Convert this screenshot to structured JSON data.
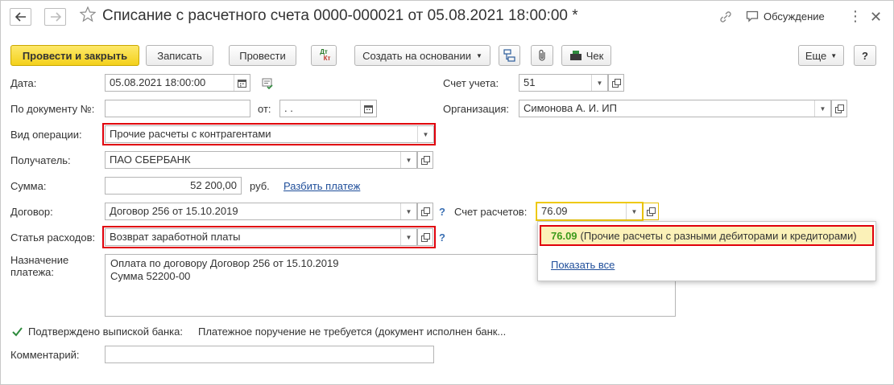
{
  "header": {
    "title": "Списание с расчетного счета 0000-000021 от 05.08.2021 18:00:00 *",
    "discussion": "Обсуждение"
  },
  "toolbar": {
    "post_close": "Провести и закрыть",
    "save": "Записать",
    "post": "Провести",
    "dtkt_dt": "Дт",
    "dtkt_kt": "Кт",
    "create_based": "Создать на основании",
    "check": "Чек",
    "more": "Еще",
    "help": "?"
  },
  "form": {
    "date_label": "Дата:",
    "date_value": "05.08.2021 18:00:00",
    "doc_label": "По документу №:",
    "doc_value": "",
    "from_label": "от:",
    "from_value": " .  .",
    "operation_label": "Вид операции:",
    "operation_value": "Прочие расчеты с контрагентами",
    "recipient_label": "Получатель:",
    "recipient_value": "ПАО СБЕРБАНК",
    "sum_label": "Сумма:",
    "sum_value": "52 200,00",
    "currency": "руб.",
    "split_link": "Разбить платеж",
    "contract_label": "Договор:",
    "contract_value": "Договор 256 от 15.10.2019",
    "expense_label": "Статья расходов:",
    "expense_value": "Возврат заработной платы",
    "purpose_label_1": "Назначение",
    "purpose_label_2": "платежа:",
    "purpose_line_1": "Оплата по договору Договор 256 от 15.10.2019",
    "purpose_line_2": "Сумма 52200-00",
    "confirmed_label": "Подтверждено выпиской банка:",
    "confirmed_checked": true,
    "order_note": "Платежное поручение не требуется (документ исполнен банк...",
    "comment_label": "Комментарий:",
    "comment_value": "",
    "account_label": "Счет учета:",
    "account_value": "51",
    "org_label": "Организация:",
    "org_value": "Симонова А. И. ИП",
    "settle_label": "Счет расчетов:",
    "settle_value": "76.09",
    "help_mark": "?"
  },
  "popup": {
    "item_code": "76.09",
    "item_desc": "(Прочие расчеты с разными дебиторами и кредиторами)",
    "show_all": "Показать все"
  },
  "colors": {
    "highlight_red": "#e0000b",
    "primary_yellow": "#f4d11b",
    "link_blue": "#1f4e9a",
    "code_green": "#3c9a1b"
  }
}
